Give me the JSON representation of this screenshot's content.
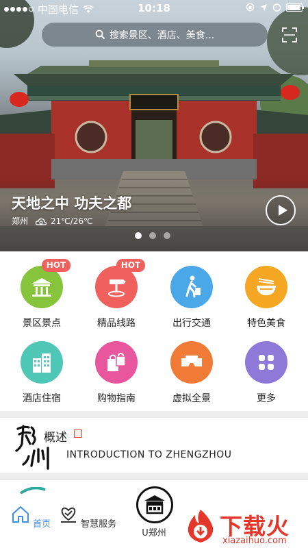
{
  "status_bar": {
    "carrier": "中国电信",
    "time": "10:18"
  },
  "search": {
    "placeholder": "搜索景区、酒店、美食..."
  },
  "hero": {
    "gate_plaque": "少林寺",
    "title": "天地之中 功夫之都",
    "city": "郑州",
    "weather": "21℃/26℃",
    "pager_count": 3,
    "pager_active": 0
  },
  "grid": {
    "items": [
      {
        "label": "景区景点",
        "badge": "HOT",
        "color": "#86c43c",
        "icon": "scenic-spot-icon"
      },
      {
        "label": "精品线路",
        "badge": "HOT",
        "color": "#f0605d",
        "icon": "signpost-icon"
      },
      {
        "label": "出行交通",
        "badge": "",
        "color": "#4aa7e8",
        "icon": "walking-luggage-icon"
      },
      {
        "label": "特色美食",
        "badge": "",
        "color": "#f5a623",
        "icon": "noodle-bowl-icon"
      },
      {
        "label": "酒店住宿",
        "badge": "",
        "color": "#4fc7b6",
        "icon": "hotel-buildings-icon"
      },
      {
        "label": "购物指南",
        "badge": "",
        "color": "#e8579d",
        "icon": "shopping-bags-icon"
      },
      {
        "label": "虚拟全景",
        "badge": "",
        "color": "#f07b36",
        "icon": "vr-glasses-icon"
      },
      {
        "label": "更多",
        "badge": "",
        "color": "#8f79d8",
        "icon": "more-grid-icon"
      }
    ]
  },
  "intro": {
    "calligraphy": "郑州",
    "title": "概述",
    "subtitle": "INTRODUCTION TO ZHENGZHOU"
  },
  "tabbar": {
    "tabs": [
      {
        "label": "首页",
        "icon": "home-icon",
        "active": true
      },
      {
        "label": "智慧服务",
        "icon": "heart-hand-icon",
        "active": false
      },
      {
        "label": "U郑州",
        "icon": "u-zhengzhou-badge-icon",
        "active": false
      }
    ]
  },
  "watermark": {
    "text": "下载火",
    "url": "xiazaihuo.com"
  },
  "colors": {
    "accent": "#3f8ee0",
    "hot_badge": "#f0605d",
    "watermark": "#e4372a"
  }
}
